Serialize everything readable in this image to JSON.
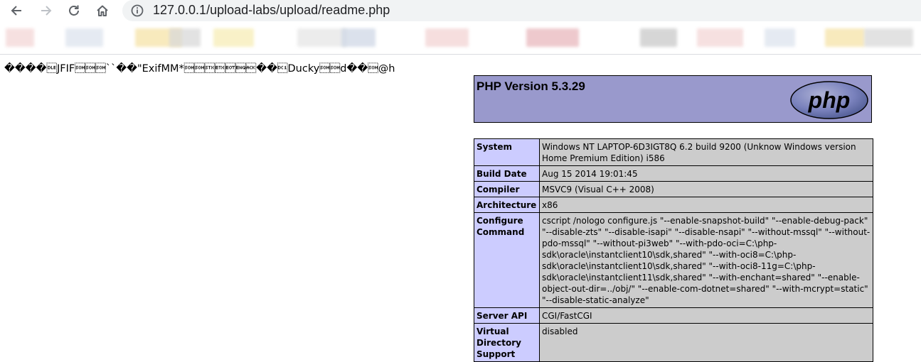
{
  "browser": {
    "url": "127.0.0.1/upload-labs/upload/readme.php",
    "back_icon": "arrow-left-icon",
    "forward_icon": "arrow-right-icon",
    "reload_icon": "reload-icon",
    "home_icon": "home-icon",
    "site_info_icon": "info-circle-icon",
    "bookmark_colors": [
      "#f4d6d6",
      "#dde4ee",
      "#f6e3a8",
      "#d9d9d9",
      "#f7edb6",
      "#e6e6e6",
      "#cfd8e6",
      "#f3d4d4",
      "#e9b8bd",
      "#c9c9c9"
    ]
  },
  "page": {
    "garbage_text": "����\u0010JFIF\u0001\u0001\u0001``��\"ExifMM*\u0001\u0001\u0002\u0003\u0004\u0005\u0006��\u0011Ducky\u0001\u0001d��\u0001@h"
  },
  "phpinfo": {
    "version": "PHP Version 5.3.29",
    "logo_text": "php",
    "rows": [
      {
        "key": "System",
        "value": "Windows NT LAPTOP-6D3IGT8Q 6.2 build 9200 (Unknow Windows version Home Premium Edition) i586"
      },
      {
        "key": "Build Date",
        "value": "Aug 15 2014 19:01:45"
      },
      {
        "key": "Compiler",
        "value": "MSVC9 (Visual C++ 2008)"
      },
      {
        "key": "Architecture",
        "value": "x86"
      },
      {
        "key": "Configure Command",
        "value": "cscript /nologo configure.js \"--enable-snapshot-build\" \"--enable-debug-pack\" \"--disable-zts\" \"--disable-isapi\" \"--disable-nsapi\" \"--without-mssql\" \"--without-pdo-mssql\" \"--without-pi3web\" \"--with-pdo-oci=C:\\php-sdk\\oracle\\instantclient10\\sdk,shared\" \"--with-oci8=C:\\php-sdk\\oracle\\instantclient10\\sdk,shared\" \"--with-oci8-11g=C:\\php-sdk\\oracle\\instantclient11\\sdk,shared\" \"--with-enchant=shared\" \"--enable-object-out-dir=../obj/\" \"--enable-com-dotnet=shared\" \"--with-mcrypt=static\" \"--disable-static-analyze\""
      },
      {
        "key": "Server API",
        "value": "CGI/FastCGI"
      },
      {
        "key": "Virtual Directory Support",
        "value": "disabled"
      }
    ]
  }
}
